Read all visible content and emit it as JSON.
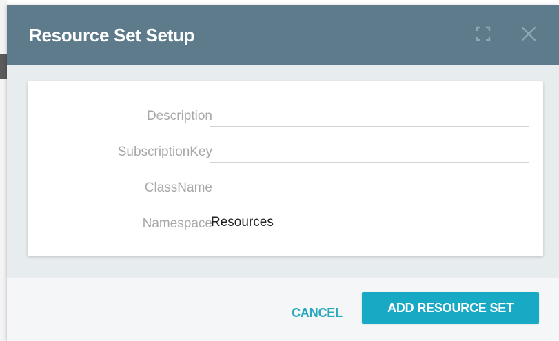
{
  "dialog": {
    "title": "Resource Set Setup",
    "header_color": "#5d7b8b",
    "maximize_icon": "maximize-icon",
    "close_icon": "close-icon"
  },
  "form": {
    "fields": [
      {
        "label": "Description",
        "value": ""
      },
      {
        "label": "SubscriptionKey",
        "value": ""
      },
      {
        "label": "ClassName",
        "value": ""
      },
      {
        "label": "Namespace",
        "value": "Resources"
      }
    ]
  },
  "footer": {
    "cancel_label": "CANCEL",
    "add_label": "ADD RESOURCE SET",
    "accent_color": "#18a9c4"
  }
}
